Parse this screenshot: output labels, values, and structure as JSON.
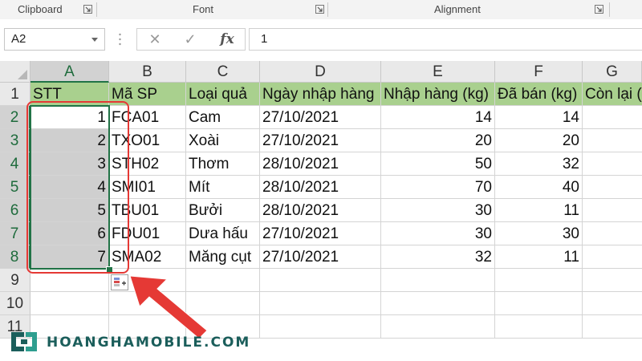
{
  "ribbon": {
    "groups": [
      {
        "label": "Clipboard"
      },
      {
        "label": "Font"
      },
      {
        "label": "Alignment"
      }
    ]
  },
  "formula_bar": {
    "name_box": "A2",
    "value": "1",
    "cancel_symbol": "✕",
    "enter_symbol": "✓",
    "fx_symbol": "fx"
  },
  "sheet": {
    "columns": [
      "A",
      "B",
      "C",
      "D",
      "E",
      "F",
      "G"
    ],
    "rows": [
      "1",
      "2",
      "3",
      "4",
      "5",
      "6",
      "7",
      "8",
      "9",
      "10",
      "11"
    ],
    "header_row": [
      "STT",
      "Mã SP",
      "Loại quả",
      "Ngày nhập hàng",
      "Nhập hàng (kg)",
      "Đã bán (kg)",
      "Còn lại (kg)"
    ],
    "data": [
      {
        "stt": "1",
        "ma": "FCA01",
        "loai": "Cam",
        "ngay": "27/10/2021",
        "nhap": "14",
        "ban": "14"
      },
      {
        "stt": "2",
        "ma": "TXO01",
        "loai": "Xoài",
        "ngay": "27/10/2021",
        "nhap": "20",
        "ban": "20"
      },
      {
        "stt": "3",
        "ma": "STH02",
        "loai": "Thơm",
        "ngay": "28/10/2021",
        "nhap": "50",
        "ban": "32"
      },
      {
        "stt": "4",
        "ma": "SMI01",
        "loai": "Mít",
        "ngay": "28/10/2021",
        "nhap": "70",
        "ban": "40"
      },
      {
        "stt": "5",
        "ma": "TBU01",
        "loai": "Bưởi",
        "ngay": "28/10/2021",
        "nhap": "30",
        "ban": "11"
      },
      {
        "stt": "6",
        "ma": "FDU01",
        "loai": "Dưa hấu",
        "ngay": "27/10/2021",
        "nhap": "30",
        "ban": "30"
      },
      {
        "stt": "7",
        "ma": "SMA02",
        "loai": "Măng cụt",
        "ngay": "27/10/2021",
        "nhap": "32",
        "ban": "11"
      }
    ]
  },
  "watermark": {
    "text": "HOANGHAMOBILE.COM"
  },
  "colors": {
    "header_fill": "#a9d08e",
    "selection_border": "#217346",
    "annotation_red": "#e53935",
    "selected_fill": "#cfcfcf"
  }
}
